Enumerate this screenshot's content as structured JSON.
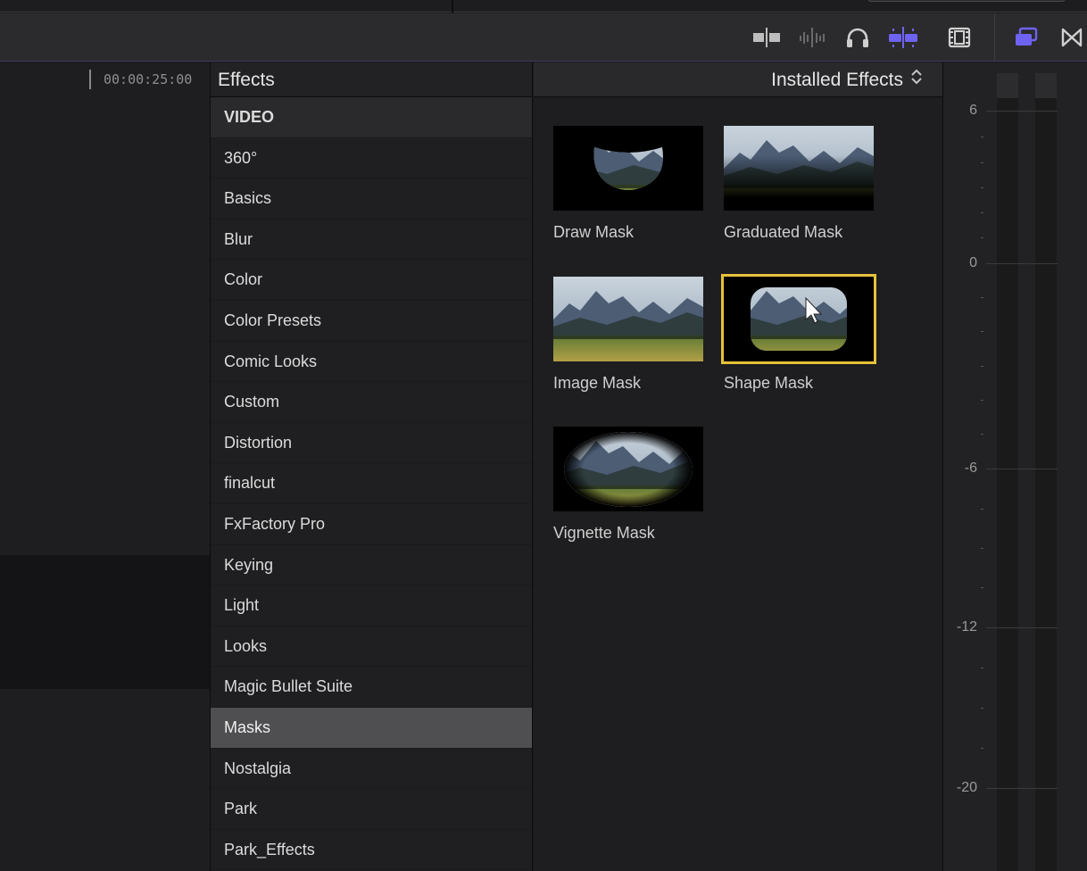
{
  "timeline": {
    "timecode": "00:00:25:00"
  },
  "toolbar": {
    "icons": [
      "skimming-icon",
      "audio-skimming-icon",
      "headphones-icon",
      "snapping-icon",
      "clip-appearance-icon",
      "effects-browser-icon",
      "transitions-browser-icon"
    ],
    "accent": "#6e63f0"
  },
  "sidebar": {
    "title": "Effects",
    "section": "VIDEO",
    "categories": [
      "360°",
      "Basics",
      "Blur",
      "Color",
      "Color Presets",
      "Comic Looks",
      "Custom",
      "Distortion",
      "finalcut",
      "FxFactory Pro",
      "Keying",
      "Light",
      "Looks",
      "Magic Bullet Suite",
      "Masks",
      "Nostalgia",
      "Park",
      "Park_Effects"
    ],
    "selected": "Masks"
  },
  "browser": {
    "filter": "Installed Effects",
    "effects": [
      "Draw Mask",
      "Graduated Mask",
      "Image Mask",
      "Shape Mask",
      "Vignette Mask"
    ],
    "selected": "Shape Mask",
    "selection_color": "#e7c23a"
  },
  "meters": {
    "scale": [
      "6",
      "0",
      "-6",
      "-12",
      "-20"
    ]
  }
}
